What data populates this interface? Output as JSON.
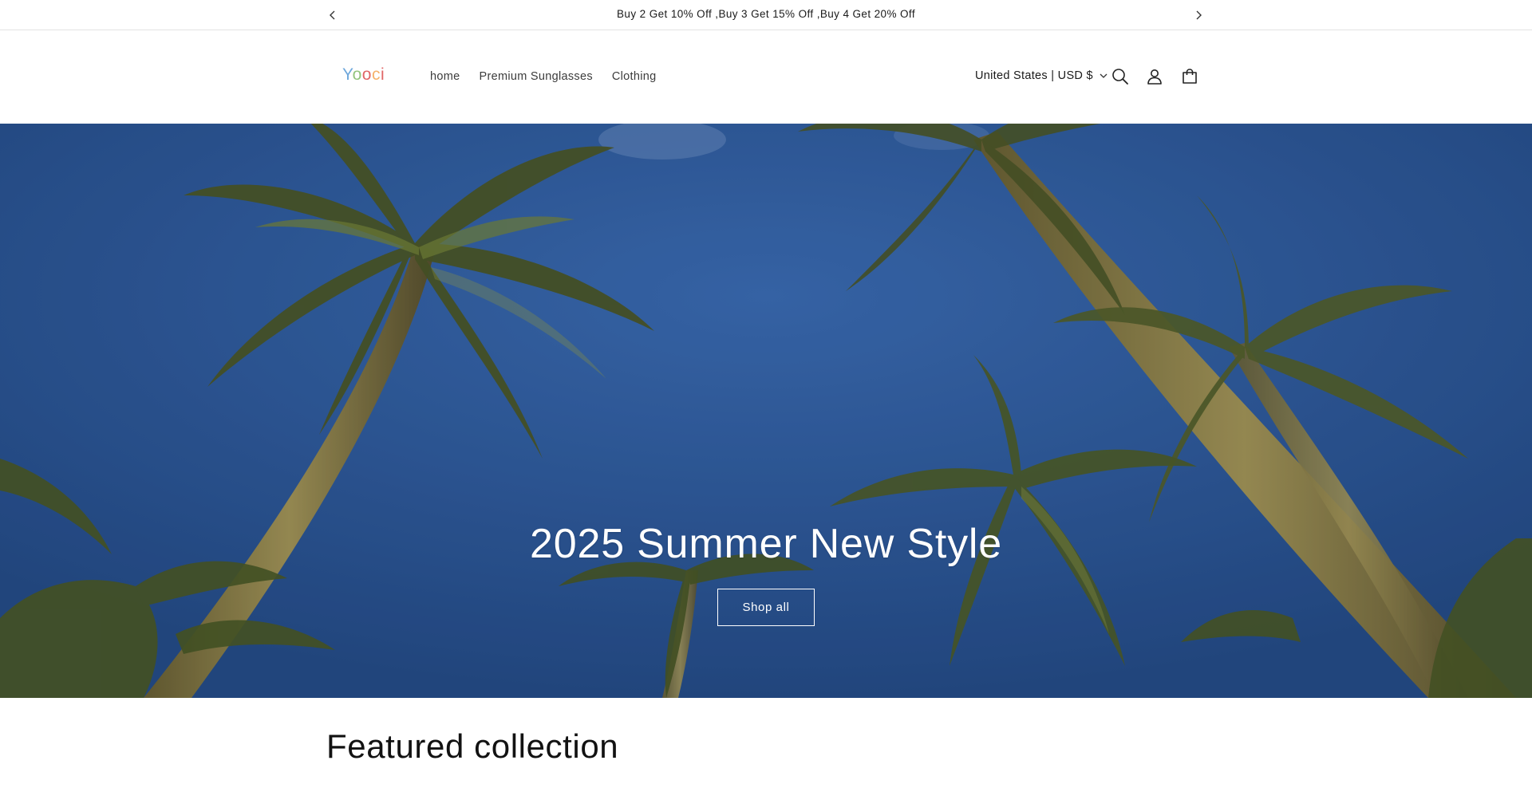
{
  "announcement": {
    "text": "Buy 2 Get 10% Off ,Buy 3 Get 15% Off ,Buy 4 Get 20% Off",
    "prev_icon": "chevron-left-icon",
    "next_icon": "chevron-right-icon"
  },
  "header": {
    "logo": {
      "letters": [
        "Y",
        "o",
        "o",
        "c",
        "i"
      ],
      "colors": [
        "#6fa8dc",
        "#93c47d",
        "#e06666",
        "#f6b26b",
        "#e06666"
      ]
    },
    "nav": [
      {
        "label": "home"
      },
      {
        "label": "Premium Sunglasses"
      },
      {
        "label": "Clothing"
      }
    ],
    "locale": "United States | USD $",
    "icons": [
      "search-icon",
      "account-icon",
      "cart-icon"
    ]
  },
  "hero": {
    "title": "2025 Summer New Style",
    "button": "Shop all",
    "sky_color": "#3566b0"
  },
  "featured": {
    "title": "Featured collection"
  }
}
